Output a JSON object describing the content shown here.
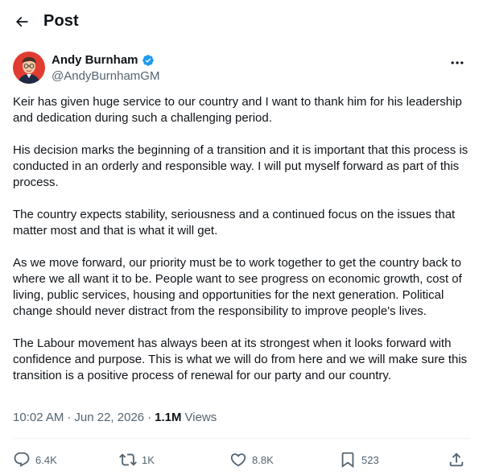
{
  "header": {
    "title": "Post",
    "back_icon": "arrow-left-icon"
  },
  "author": {
    "display_name": "Andy Burnham",
    "handle": "@AndyBurnhamGM",
    "verified_icon": "verified-badge-icon",
    "verified_color": "#1d9bf0"
  },
  "post": {
    "paragraphs": [
      "Keir has given huge service to our country and I want to thank him for his leadership and dedication during such a challenging period.",
      "His decision marks the beginning of a transition and it is important that this process is conducted in an orderly and responsible way. I will put myself forward as part of this process.",
      "The country expects stability, seriousness and a continued focus on the issues that matter most and that is what it will get.",
      "As we move forward, our priority must be to work together to get the country back to where we all want it to be. People want to see progress on economic growth, cost of living, public services, housing and opportunities for the next generation. Political change should never distract from the responsibility to improve people's lives.",
      "The Labour movement has always been at its strongest when it looks forward with confidence and purpose. This is what we will do from here and we will make sure this transition is a positive process of renewal for our party and our country."
    ],
    "time": "10:02 AM",
    "separator": "·",
    "date": "Jun 22, 2026",
    "views_count": "1.1M",
    "views_label": "Views"
  },
  "actions": {
    "replies": "6.4K",
    "reposts": "1K",
    "likes": "8.8K",
    "bookmarks": "523"
  },
  "colors": {
    "text": "#0f1419",
    "secondary": "#536471",
    "divider": "#eff3f4",
    "avatar_bg": "#e03c31"
  }
}
